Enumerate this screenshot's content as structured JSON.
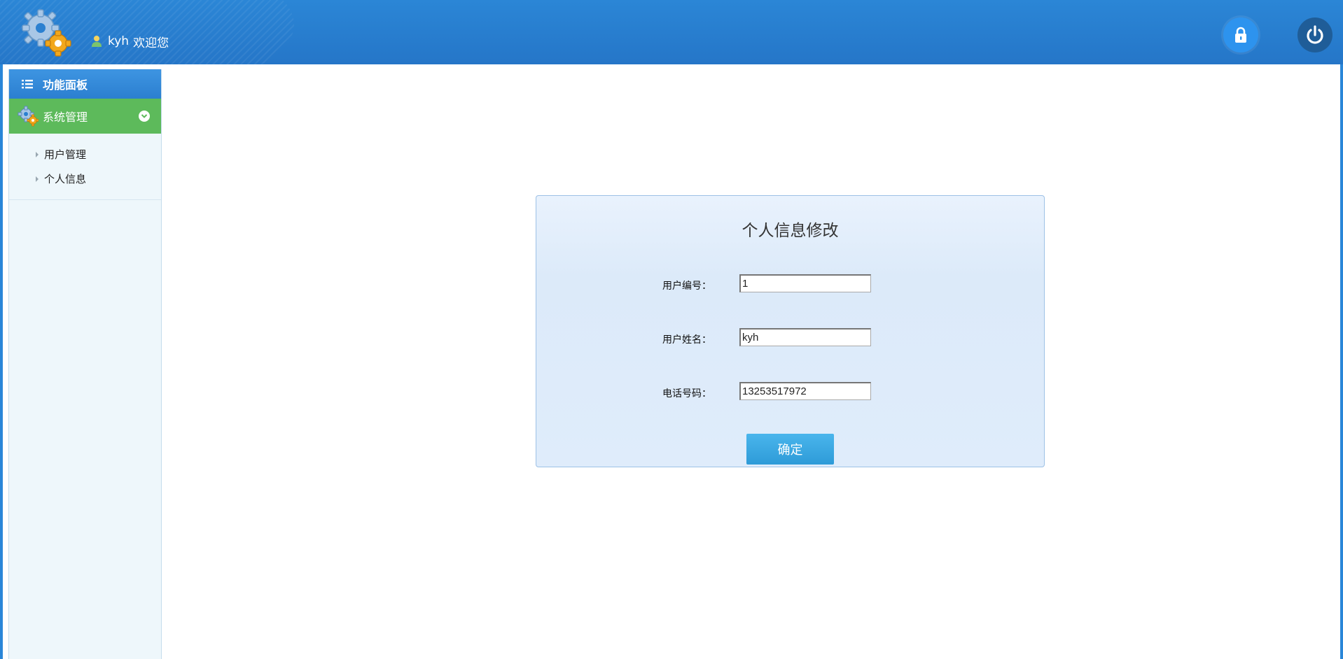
{
  "header": {
    "username": "kyh",
    "welcome_text": "欢迎您",
    "lock_icon": "lock-icon",
    "power_icon": "power-icon"
  },
  "sidebar": {
    "title": "功能面板",
    "group": {
      "label": "系统管理",
      "icon": "gear-icon",
      "expanded": true
    },
    "items": [
      {
        "label": "用户管理"
      },
      {
        "label": "个人信息"
      }
    ]
  },
  "form": {
    "title": "个人信息修改",
    "fields": [
      {
        "label": "用户编号：",
        "value": "1"
      },
      {
        "label": "用户姓名：",
        "value": "kyh"
      },
      {
        "label": "电话号码：",
        "value": "13253517972"
      }
    ],
    "submit_label": "确定"
  },
  "colors": {
    "header_bg": "#2576c8",
    "sidebar_group_bg": "#5dba5b",
    "button_bg": "#2e9bd8",
    "panel_border": "#9dc1e6"
  }
}
